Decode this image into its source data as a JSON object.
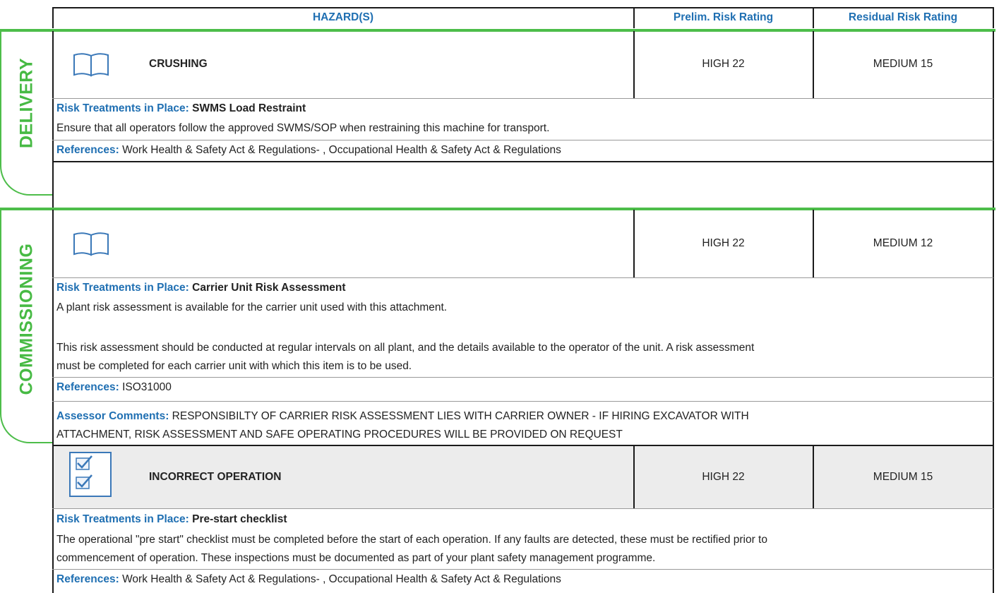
{
  "header": {
    "hazards": "HAZARD(S)",
    "prelim": "Prelim. Risk Rating",
    "residual": "Residual Risk Rating"
  },
  "sections": [
    {
      "label": "DELIVERY",
      "hazards": [
        {
          "icon": "book-icon",
          "title": "CRUSHING",
          "prelim": "HIGH 22",
          "residual": "MEDIUM 15",
          "treatment_label": "Risk Treatments in Place:",
          "treatment_name": "SWMS Load Restraint",
          "treatment_text": [
            "Ensure that all operators follow the approved SWMS/SOP when restraining this machine for transport."
          ],
          "references_label": "References:",
          "references": "Work Health & Safety Act & Regulations- , Occupational Health & Safety Act & Regulations"
        }
      ]
    },
    {
      "label": "COMMISSIONING",
      "hazards": [
        {
          "icon": "book-icon",
          "title": "",
          "prelim": "HIGH 22",
          "residual": "MEDIUM 12",
          "treatment_label": "Risk Treatments in Place:",
          "treatment_name": "Carrier Unit Risk Assessment",
          "treatment_text": [
            "A plant risk assessment is available for the carrier unit used with this attachment.",
            "This risk assessment should be conducted at regular intervals on all plant, and the details available to the operator of the unit. A risk assessment",
            "must be completed for each carrier unit with which this item is to be used."
          ],
          "references_label": "References:",
          "references": "ISO31000",
          "assessor_label": "Assessor Comments:",
          "assessor_lines": [
            "RESPONSIBILTY OF CARRIER RISK ASSESSMENT LIES WITH CARRIER OWNER - IF HIRING EXCAVATOR WITH",
            "ATTACHMENT, RISK ASSESSMENT AND SAFE OPERATING PROCEDURES WILL BE PROVIDED ON REQUEST"
          ]
        },
        {
          "icon": "checklist-icon",
          "title": "INCORRECT OPERATION",
          "prelim": "HIGH 22",
          "residual": "MEDIUM 15",
          "treatment_label": "Risk Treatments in Place:",
          "treatment_name": "Pre-start checklist",
          "treatment_text": [
            "The operational \"pre start\" checklist must be completed before the start of each operation. If any faults are detected, these must be rectified prior to",
            "commencement of operation. These inspections must be documented as part of your plant safety management programme."
          ],
          "references_label": "References:",
          "references": "Work Health & Safety Act & Regulations- , Occupational Health & Safety Act & Regulations"
        }
      ]
    }
  ],
  "colors": {
    "accent_blue": "#1f6fb2",
    "section_green": "#4dbd4a",
    "grey_row": "#ececec"
  }
}
